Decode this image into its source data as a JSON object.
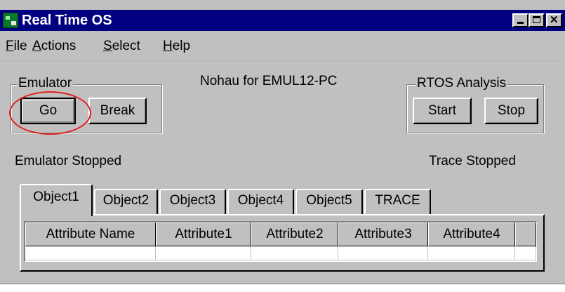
{
  "window": {
    "title": "Real Time OS"
  },
  "menu": {
    "items": [
      "File",
      "Actions",
      "Select",
      "Help"
    ]
  },
  "emulator": {
    "legend": "Emulator",
    "go_label": "Go",
    "break_label": "Break",
    "status": "Emulator Stopped"
  },
  "device_label": "Nohau for EMUL12-PC",
  "rtos": {
    "legend": "RTOS  Analysis",
    "start_label": "Start",
    "stop_label": "Stop",
    "status": "Trace Stopped"
  },
  "tabs": [
    "Object1",
    "Object2",
    "Object3",
    "Object4",
    "Object5",
    "TRACE"
  ],
  "grid": {
    "columns": [
      "Attribute Name",
      "Attribute1",
      "Attribute2",
      "Attribute3",
      "Attribute4"
    ]
  },
  "colors": {
    "title_bar": "#000080",
    "face": "#c0c0c0",
    "highlight_ring": "#e02020"
  },
  "icons": [
    "app-icon",
    "minimize-icon",
    "maximize-icon",
    "close-icon"
  ]
}
